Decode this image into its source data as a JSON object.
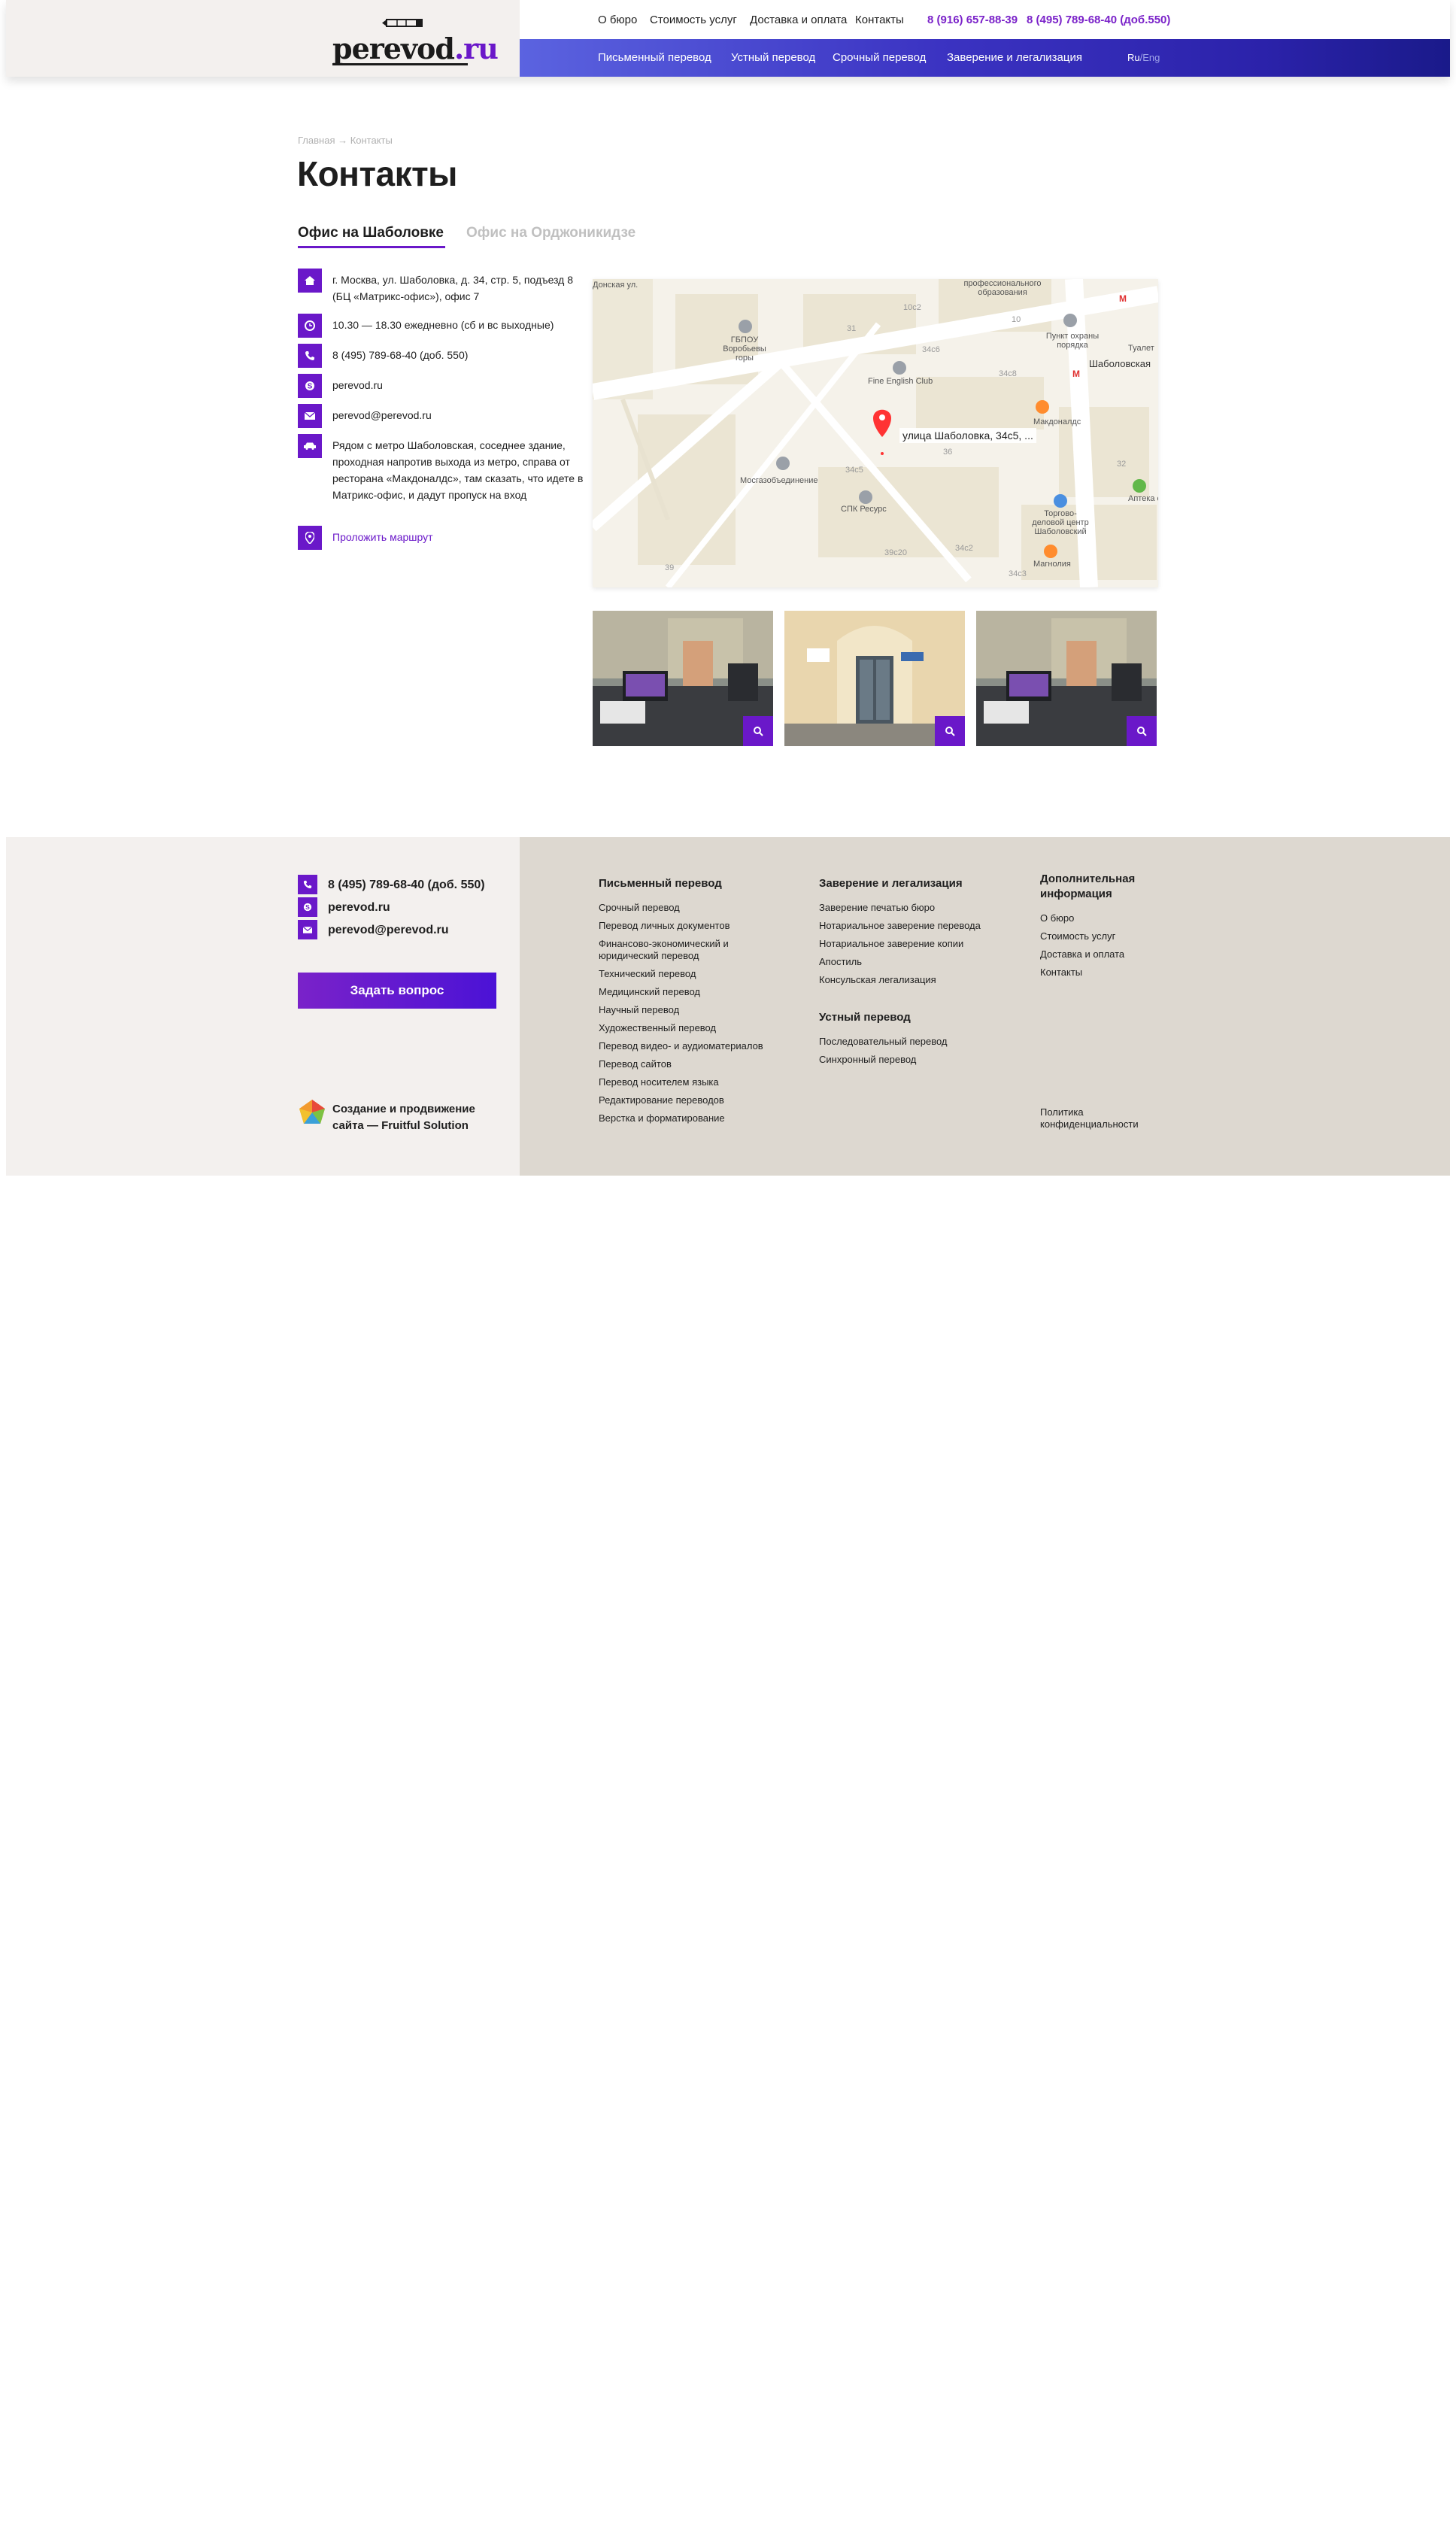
{
  "header": {
    "logo_text": "perevod",
    "logo_tld": ".ru",
    "top_nav": [
      "О бюро",
      "Стоимость услуг",
      "Доставка и оплата",
      "Контакты"
    ],
    "phone_1": "8 (916) 657-88-39",
    "phone_2": "8 (495) 789-68-40 (доб.550)",
    "sub_nav": [
      "Письменный перевод",
      "Устный перевод",
      "Срочный перевод",
      "Заверение и легализация"
    ],
    "lang_active": "Ru",
    "lang_separator": "/",
    "lang_other": "Eng"
  },
  "breadcrumb": "Главная → Контакты",
  "page_title": "Контакты",
  "tabs": [
    "Офис на Шаболовке",
    "Офис на Орджоникидзе"
  ],
  "contacts": {
    "address": "г. Москва, ул. Шаболовка, д. 34, стр. 5, подъезд 8 (БЦ «Матрикс-офис»), офис 7",
    "hours": "10.30 — 18.30 ежедневно (сб и вс выходные)",
    "phone": "8 (495) 789-68-40 (доб. 550)",
    "skype": "perevod.ru",
    "email": "perevod@perevod.ru",
    "directions": "Рядом с метро Шаболовская, соседнее здание, проходная напротив выхода из метро, справа от ресторана «Макдоналдс», там сказать, что идете в Матрикс-офис, и дадут пропуск на вход",
    "route_link": "Проложить маршрут"
  },
  "map": {
    "pin_label": "улица Шаболовка, 34с5, ...",
    "labels": [
      "ГБПОУ Воробьевы горы",
      "Fine English Club",
      "Мосгазобъединение",
      "СПК Ресурс",
      "Пункт охраны порядка",
      "Шаболовская",
      "Туалет",
      "Макдоналдс",
      "Торгово-деловой центр Шаболовский",
      "Магнолия",
      "Аптека столичная",
      "Донская ул.",
      "профессионального образования",
      "34с5",
      "34с6",
      "34с8",
      "34с2",
      "34с3",
      "39",
      "31",
      "32",
      "10",
      "10с2",
      "36",
      "39с20"
    ]
  },
  "footer": {
    "phone": "8 (495) 789-68-40 (доб. 550)",
    "skype": "perevod.ru",
    "email": "perevod@perevod.ru",
    "ask_button": "Задать вопрос",
    "credit": "Создание и продвижение сайта — Fruitful Solution",
    "col1": {
      "title": "Письменный перевод",
      "links": [
        "Срочный перевод",
        "Перевод личных документов",
        "Финансово-экономический и юридический перевод",
        "Технический перевод",
        "Медицинский перевод",
        "Научный перевод",
        "Художественный перевод",
        "Перевод видео- и аудиоматериалов",
        "Перевод сайтов",
        "Перевод носителем языка",
        "Редактирование переводов",
        "Верстка и форматирование"
      ]
    },
    "col2": {
      "title": "Заверение и легализация",
      "links": [
        "Заверение печатью бюро",
        "Нотариальное заверение перевода",
        "Нотариальное заверение копии",
        "Апостиль",
        "Консульская легализация"
      ],
      "title2": "Устный перевод",
      "links2": [
        "Последовательный перевод",
        "Синхронный перевод"
      ]
    },
    "col3": {
      "title": "Дополнительная информация",
      "links": [
        "О бюро",
        "Стоимость услуг",
        "Доставка и оплата",
        "Контакты"
      ],
      "privacy": "Политика конфиденциальности"
    }
  },
  "colors": {
    "accent": "#6a18c9",
    "header_bg": "#f3f0ee",
    "footer_right_bg": "#ddd8d0"
  }
}
